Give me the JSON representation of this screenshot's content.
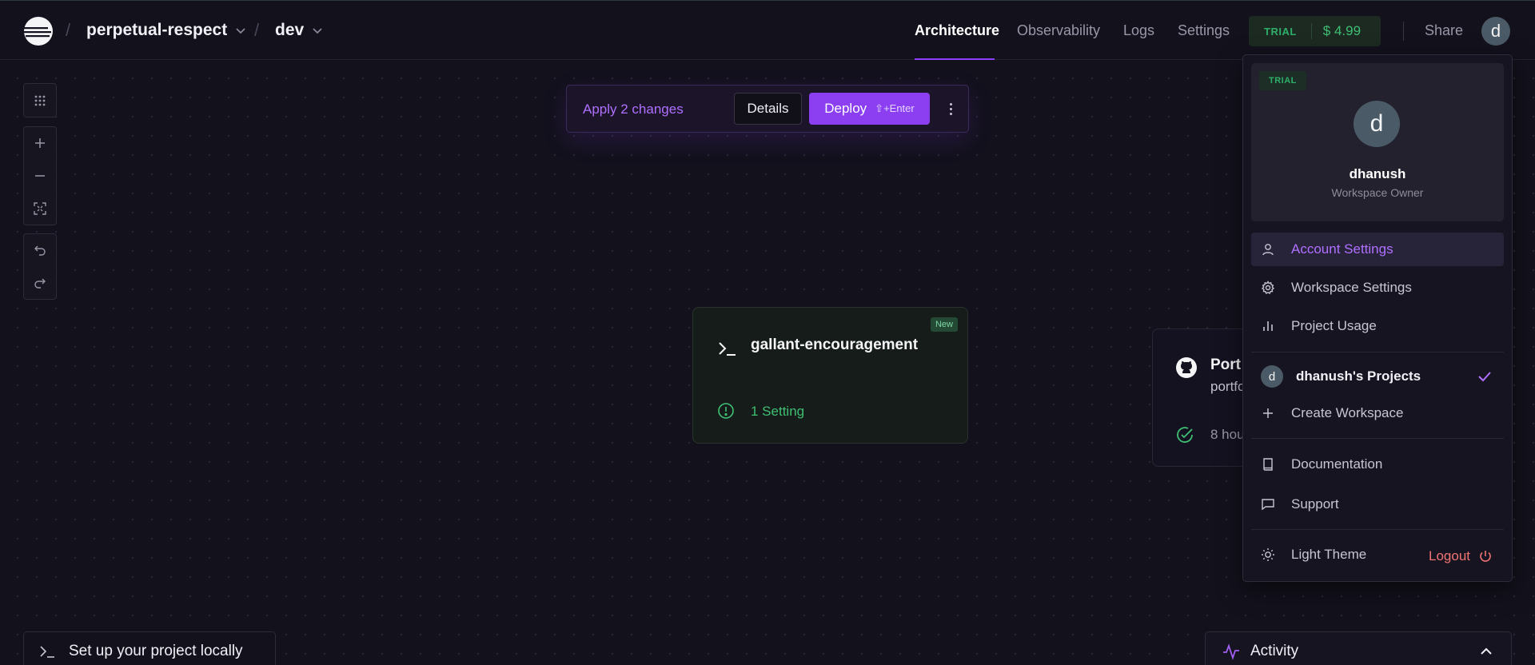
{
  "header": {
    "project_name": "perpetual-respect",
    "environment": "dev",
    "crumb_separator": "/",
    "nav": [
      "Architecture",
      "Observability",
      "Logs",
      "Settings"
    ],
    "active_nav": "Architecture",
    "plan_badge": "TRIAL",
    "plan_amount": "$ 4.99",
    "share_label": "Share",
    "avatar_initial": "d"
  },
  "deploy_bar": {
    "apply_text": "Apply 2 changes",
    "details_label": "Details",
    "deploy_label": "Deploy",
    "deploy_shortcut": "⇧+Enter"
  },
  "service_card": {
    "badge": "New",
    "title": "gallant-encouragement",
    "setting": "1 Setting"
  },
  "repo_card": {
    "title": "Port",
    "subtitle": "portfo",
    "time": "8 hou"
  },
  "account_menu": {
    "plan_badge": "TRIAL",
    "avatar_initial": "d",
    "user_name": "dhanush",
    "user_role": "Workspace Owner",
    "items_top": [
      {
        "label": "Account Settings",
        "icon": "user-icon",
        "active": true
      },
      {
        "label": "Workspace Settings",
        "icon": "gear-icon",
        "active": false
      },
      {
        "label": "Project Usage",
        "icon": "bar-chart-icon",
        "active": false
      }
    ],
    "workspace": {
      "initial": "d",
      "label": "dhanush's Projects",
      "selected": true
    },
    "create_workspace": "Create Workspace",
    "items_help": [
      {
        "label": "Documentation",
        "icon": "book-icon"
      },
      {
        "label": "Support",
        "icon": "chat-icon"
      }
    ],
    "theme_label": "Light Theme",
    "logout_label": "Logout"
  },
  "bottom": {
    "local_setup_label": "Set up your project locally",
    "activity_label": "Activity"
  },
  "colors": {
    "accent": "#8b3ff0",
    "success": "#3fbf73",
    "danger": "#f07474",
    "background": "#13111c"
  }
}
